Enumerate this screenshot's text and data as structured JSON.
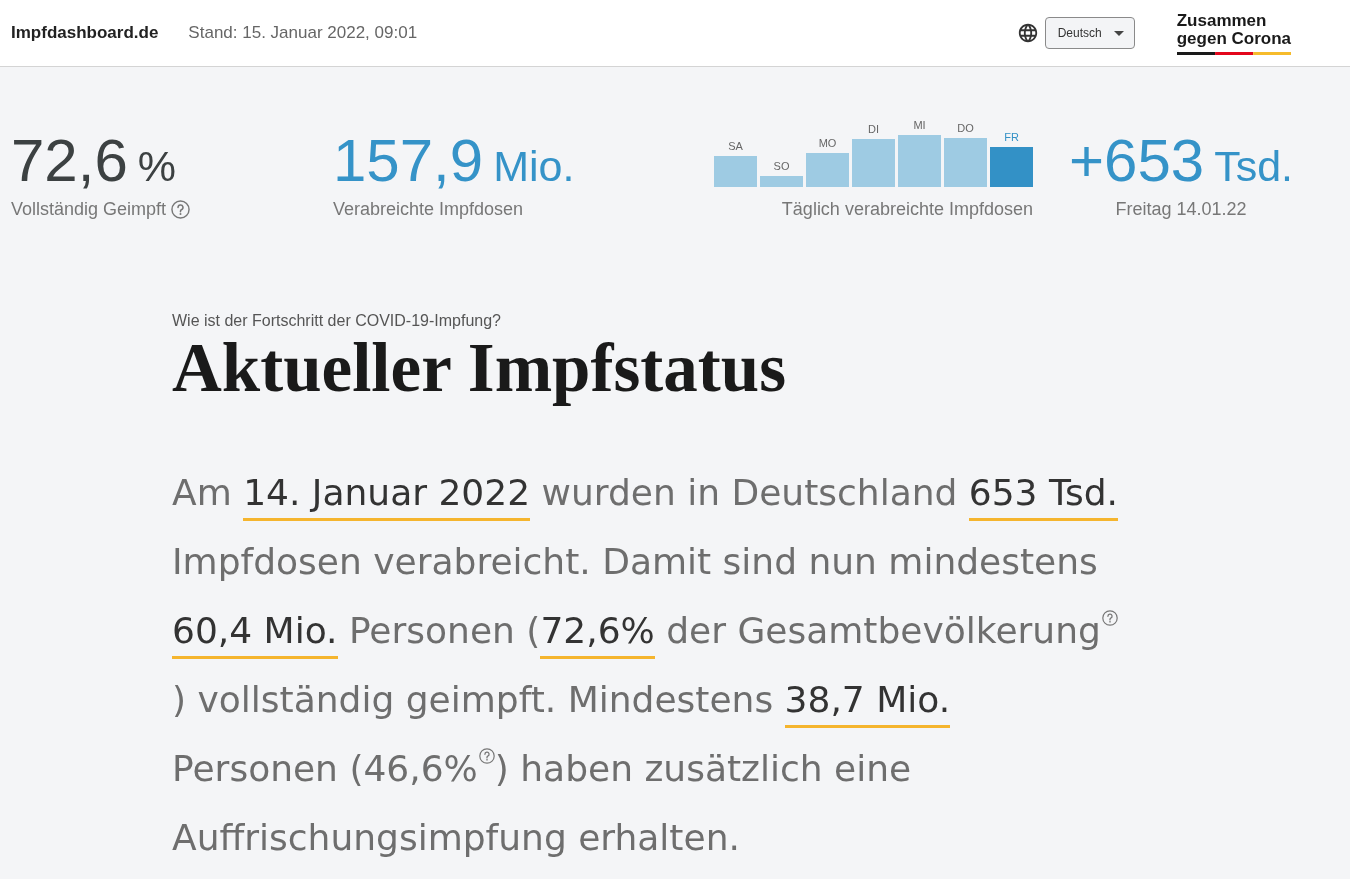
{
  "header": {
    "site_title": "Impfdashboard.de",
    "timestamp": "Stand: 15. Januar 2022, 09:01",
    "language_select": {
      "value": "Deutsch"
    },
    "logo": {
      "lines": [
        "Zusammen",
        "gegen Corona"
      ]
    }
  },
  "key_figures": [
    {
      "kind": "figure",
      "value": "72,6",
      "unit": "%",
      "label": "Vollständig Geimpft",
      "info": true,
      "color": "#3c4142"
    },
    {
      "kind": "figure",
      "value": "157,9",
      "unit": "Mio.",
      "label": "Verabreichte Impfdosen",
      "info": false,
      "color": "#3593c8"
    },
    {
      "kind": "bars",
      "bars": [
        {
          "label": "SA",
          "selected": false
        },
        {
          "label": "SO",
          "selected": false
        },
        {
          "label": "MO",
          "selected": false
        },
        {
          "label": "DI",
          "selected": false
        },
        {
          "label": "MI",
          "selected": false
        },
        {
          "label": "DO",
          "selected": false
        },
        {
          "label": "FR",
          "selected": true
        }
      ],
      "caption": "Täglich verabreichte Impfdosen"
    },
    {
      "kind": "figure",
      "value": "+653",
      "unit": "Tsd.",
      "label": "Freitag 14.01.22",
      "info": false,
      "color": "#3593c8"
    }
  ],
  "status_section": {
    "kicker": "Wie ist der Fortschritt der COVID-19-Impfung?",
    "title": "Aktueller Impfstatus",
    "paragraph": [
      {
        "kind": "text",
        "text": "Am "
      },
      {
        "kind": "value",
        "text": "14. Januar 2022"
      },
      {
        "kind": "text",
        "text": " wurden in Deutschland "
      },
      {
        "kind": "value",
        "text": "653 Tsd."
      },
      {
        "kind": "text",
        "text": " Impfdosen verabreicht. Damit sind nun mindestens "
      },
      {
        "kind": "value",
        "text": "60,4 Mio."
      },
      {
        "kind": "text",
        "text": " Personen ("
      },
      {
        "kind": "value",
        "text": "72,6%"
      },
      {
        "kind": "text",
        "text": " der Gesamtbevölkerung"
      },
      {
        "kind": "help"
      },
      {
        "kind": "text",
        "text": ") vollständig geimpft. Mindestens "
      },
      {
        "kind": "value",
        "text": "38,7 Mio."
      },
      {
        "kind": "text",
        "text": " Personen (46,6%"
      },
      {
        "kind": "help"
      },
      {
        "kind": "text",
        "text": ") haben zusätzlich eine Auffrischungsimpfung erhalten."
      }
    ]
  }
}
